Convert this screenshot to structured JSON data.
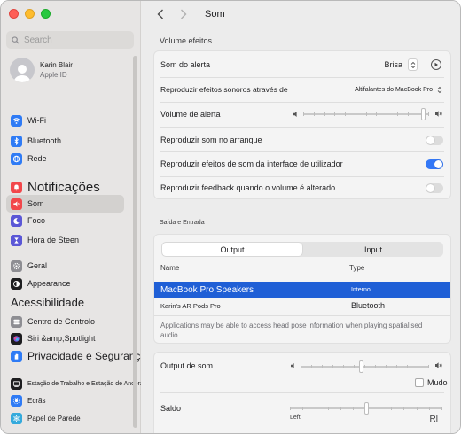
{
  "window": {
    "title": "Som"
  },
  "sidebar": {
    "search_placeholder": "Search",
    "account": {
      "name": "Karin Blair",
      "subtitle": "Apple ID"
    },
    "items": [
      {
        "label": "Wi-Fi",
        "icon": "wifi-icon",
        "color": "#2f7bf5"
      },
      {
        "label": "Bluetooth",
        "icon": "bluetooth-icon",
        "color": "#2f7bf5"
      },
      {
        "label": "Rede",
        "icon": "network-icon",
        "color": "#2f7bf5"
      },
      {
        "label": "Notificações",
        "icon": "notifications-icon",
        "color": "#f2474b"
      },
      {
        "label": "Som",
        "icon": "sound-icon",
        "color": "#f2474b"
      },
      {
        "label": "Foco",
        "icon": "focus-icon",
        "color": "#5b57d6"
      },
      {
        "label": "Hora de Steen",
        "icon": "screen-time-icon",
        "color": "#5b57d6"
      },
      {
        "label": "Geral",
        "icon": "general-icon",
        "color": "#8e8e93"
      },
      {
        "label": "Appearance",
        "icon": "appearance-icon",
        "color": "#1d1d1f"
      },
      {
        "label": "Acessibilidade",
        "icon": "accessibility-icon",
        "color": "#2f7bf5"
      },
      {
        "label": "Centro de Controlo",
        "icon": "control-center-icon",
        "color": "#8e8e93"
      },
      {
        "label": "Siri &amp;Spotlight",
        "icon": "siri-icon",
        "color": "#7a55d9"
      },
      {
        "label": "Privacidade e Segurança",
        "icon": "privacy-icon",
        "color": "#2f7bf5"
      },
      {
        "label": "Estação de Trabalho e Estação de Ancoragem",
        "icon": "desktop-dock-icon",
        "color": "#1d1d1f"
      },
      {
        "label": "Ecrãs",
        "icon": "displays-icon",
        "color": "#2f7bf5"
      },
      {
        "label": "Papel de Parede",
        "icon": "wallpaper-icon",
        "color": "#35aadc"
      }
    ]
  },
  "effects": {
    "section_title": "Volume efeitos",
    "alert_sound": {
      "label": "Som do alerta",
      "value": "Brisa"
    },
    "play_through": {
      "label": "Reproduzir efeitos sonoros através de",
      "value": "Altifalantes do MacBook Pro"
    },
    "alert_volume": {
      "label": "Volume de alerta",
      "level": 0.97
    },
    "startup_sound": {
      "label": "Reproduzir som no arranque",
      "on": false
    },
    "ui_sounds": {
      "label": "Reproduzir efeitos de som da interface de utilizador",
      "on": true
    },
    "volume_feedback": {
      "label": "Reproduzir feedback quando o volume é alterado",
      "on": false
    }
  },
  "io": {
    "section_title": "Saída e Entrada",
    "tabs": [
      "Output",
      "Input"
    ],
    "active_tab": "Output",
    "columns": [
      "Name",
      "Type"
    ],
    "devices": [
      {
        "name": "MacBook Pro Speakers",
        "type": "Interno",
        "selected": true
      },
      {
        "name": "Karin's AR Pods Pro",
        "type": "Bluetooth",
        "selected": false
      }
    ],
    "note": "Applications may be able to access head pose information when playing spatialised audio."
  },
  "output": {
    "volume_label": "Output de som",
    "volume_level": 0.47,
    "mute_label": "Mudo",
    "balance_label": "Saldo",
    "balance_left": "Left",
    "balance_right": "Rl",
    "balance_level": 0.5
  },
  "colors": {
    "accent": "#3478f6",
    "selection": "#1f5fd6"
  }
}
